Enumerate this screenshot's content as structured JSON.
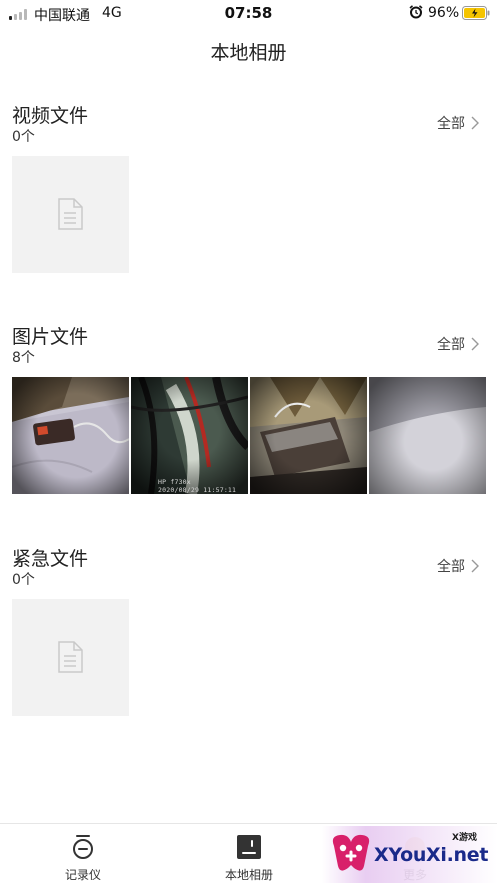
{
  "status_bar": {
    "carrier": "中国联通",
    "network": "4G",
    "time": "07:58",
    "battery_percent": "96%"
  },
  "nav": {
    "title": "本地相册"
  },
  "sections": {
    "video": {
      "title": "视频文件",
      "count": "0个",
      "all_label": "全部"
    },
    "picture": {
      "title": "图片文件",
      "count": "8个",
      "all_label": "全部",
      "thumbnail_stamp_line1": "HP f730x",
      "thumbnail_stamp_line2": "2020/08/29 11:57:11"
    },
    "emergency": {
      "title": "紧急文件",
      "count": "0个",
      "all_label": "全部"
    }
  },
  "tab_bar": {
    "tabs": [
      {
        "label": "记录仪",
        "icon": "recorder-icon"
      },
      {
        "label": "本地相册",
        "icon": "album-icon"
      },
      {
        "label": "更多",
        "icon": "more-icon"
      }
    ]
  },
  "watermark": {
    "text": "XYouXi.net",
    "small_text": "X游戏"
  },
  "colors": {
    "placeholder_bg": "#f2f2f2",
    "text_primary": "#222222",
    "battery_fill": "#f5c400"
  }
}
